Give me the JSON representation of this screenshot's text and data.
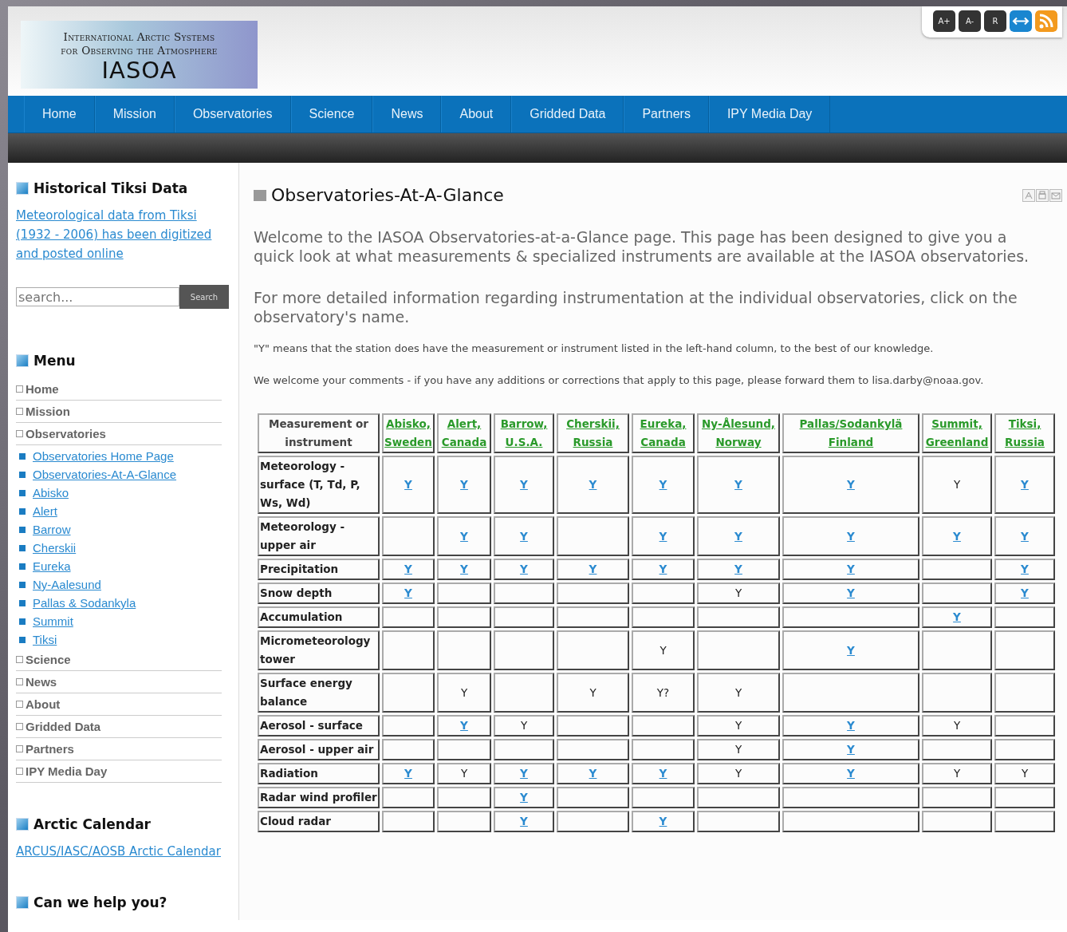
{
  "toolbar": {
    "buttons": [
      "A+",
      "A-",
      "R"
    ]
  },
  "logo": {
    "line1": "International Arctic Systems",
    "line2": "for Observing the Atmosphere",
    "name": "IASOA"
  },
  "nav": [
    "Home",
    "Mission",
    "Observatories",
    "Science",
    "News",
    "About",
    "Gridded Data",
    "Partners",
    "IPY Media Day"
  ],
  "sidebar": {
    "historical": {
      "title": "Historical Tiksi Data",
      "link": "Meteorological data from Tiksi (1932 - 2006) has been digitized and posted online"
    },
    "search": {
      "placeholder": "search...",
      "button": "Search"
    },
    "menu": {
      "title": "Menu",
      "items": [
        {
          "label": "Home"
        },
        {
          "label": "Mission"
        },
        {
          "label": "Observatories",
          "children": [
            "Observatories Home Page",
            "Observatories-At-A-Glance",
            "Abisko",
            "Alert",
            "Barrow",
            "Cherskii",
            "Eureka",
            "Ny-Aalesund",
            "Pallas & Sodankyla",
            "Summit",
            "Tiksi"
          ]
        },
        {
          "label": "Science"
        },
        {
          "label": "News"
        },
        {
          "label": "About"
        },
        {
          "label": "Gridded Data"
        },
        {
          "label": "Partners"
        },
        {
          "label": "IPY Media Day"
        }
      ]
    },
    "calendar": {
      "title": "Arctic Calendar",
      "link": "ARCUS/IASC/AOSB Arctic Calendar"
    },
    "help": {
      "title": "Can we help you?"
    }
  },
  "article": {
    "title": "Observatories-At-A-Glance",
    "intro": [
      "Welcome to the IASOA Observatories-at-a-Glance page.  This page has been designed to give you a quick look at what measurements & specialized instruments are available at the IASOA observatories.",
      "For more detailed information regarding instrumentation at the individual observatories, click on the observatory's name."
    ],
    "notes": [
      "\"Y\" means that the station does have the measurement or instrument listed in the left-hand column, to the best of our knowledge.",
      "We welcome your comments - if you have any additions or corrections that apply to this page, please forward them to lisa.darby@noaa.gov."
    ]
  },
  "table": {
    "columns": [
      {
        "label": "Measurement or instrument",
        "link": false
      },
      {
        "label": "Abisko, Sweden",
        "link": true
      },
      {
        "label": "Alert, Canada",
        "link": true
      },
      {
        "label": "Barrow, U.S.A.",
        "link": true
      },
      {
        "label": "Cherskii, Russia",
        "link": true
      },
      {
        "label": "Eureka, Canada",
        "link": true
      },
      {
        "label": "Ny-Ålesund, Norway",
        "link": true
      },
      {
        "label": "Pallas/Sodankylä Finland",
        "link": true
      },
      {
        "label": "Summit, Greenland",
        "link": true
      },
      {
        "label": "Tiksi, Russia",
        "link": true
      }
    ],
    "rows": [
      {
        "cells": [
          {
            "text": "Meteorology - surface (T, Td, P, Ws, Wd)",
            "link": false
          },
          {
            "text": "Y",
            "link": true
          },
          {
            "text": "Y",
            "link": true
          },
          {
            "text": "Y",
            "link": true
          },
          {
            "text": "Y",
            "link": true
          },
          {
            "text": "Y",
            "link": true
          },
          {
            "text": "Y",
            "link": true
          },
          {
            "text": "Y",
            "link": true
          },
          {
            "text": "Y",
            "link": false
          },
          {
            "text": "Y",
            "link": true
          }
        ]
      },
      {
        "cells": [
          {
            "text": "Meteorology - upper air",
            "link": false
          },
          "",
          {
            "text": "Y",
            "link": true
          },
          {
            "text": "Y",
            "link": true
          },
          "",
          {
            "text": "Y",
            "link": true
          },
          {
            "text": "Y",
            "link": true
          },
          {
            "text": "Y",
            "link": true
          },
          {
            "text": "Y",
            "link": true
          },
          {
            "text": "Y",
            "link": true
          }
        ]
      },
      {
        "cells": [
          {
            "text": "Precipitation",
            "link": false
          },
          {
            "text": "Y",
            "link": true
          },
          {
            "text": "Y",
            "link": true
          },
          {
            "text": "Y",
            "link": true
          },
          {
            "text": "Y",
            "link": true
          },
          {
            "text": "Y",
            "link": true
          },
          {
            "text": "Y",
            "link": true
          },
          {
            "text": "Y",
            "link": true
          },
          "",
          {
            "text": "Y",
            "link": true
          }
        ]
      },
      {
        "cells": [
          {
            "text": "Snow depth",
            "link": false
          },
          {
            "text": "Y",
            "link": true
          },
          "",
          "",
          "",
          "",
          {
            "text": "Y",
            "link": false
          },
          {
            "text": "Y",
            "link": true
          },
          "",
          {
            "text": "Y",
            "link": true
          }
        ]
      },
      {
        "cells": [
          {
            "text": "Accumulation",
            "link": false
          },
          "",
          "",
          "",
          "",
          "",
          "",
          "",
          {
            "text": "Y",
            "link": true
          },
          ""
        ]
      },
      {
        "cells": [
          {
            "text": "Micrometeorology tower",
            "link": false
          },
          "",
          "",
          "",
          "",
          {
            "text": "Y",
            "link": false
          },
          "",
          {
            "text": "Y",
            "link": true
          },
          "",
          ""
        ]
      },
      {
        "cells": [
          {
            "text": "Surface energy balance",
            "link": false
          },
          "",
          {
            "text": "Y",
            "link": false
          },
          "",
          {
            "text": "Y",
            "link": false
          },
          {
            "text": "Y?",
            "link": false
          },
          {
            "text": "Y",
            "link": false
          },
          "",
          "",
          ""
        ]
      },
      {
        "cells": [
          {
            "text": "Aerosol - surface",
            "link": false
          },
          "",
          {
            "text": "Y",
            "link": true
          },
          {
            "text": "Y",
            "link": false
          },
          "",
          "",
          {
            "text": "Y",
            "link": false
          },
          {
            "text": "Y",
            "link": true
          },
          {
            "text": "Y",
            "link": false
          },
          ""
        ]
      },
      {
        "cells": [
          {
            "text": "Aerosol - upper air",
            "link": false
          },
          "",
          "",
          "",
          "",
          "",
          {
            "text": "Y",
            "link": false
          },
          {
            "text": "Y",
            "link": true
          },
          "",
          ""
        ]
      },
      {
        "cells": [
          {
            "text": "Radiation",
            "link": false
          },
          {
            "text": "Y",
            "link": true
          },
          {
            "text": "Y",
            "link": false
          },
          {
            "text": "Y",
            "link": true
          },
          {
            "text": "Y",
            "link": true
          },
          {
            "text": "Y",
            "link": true
          },
          {
            "text": "Y",
            "link": false
          },
          {
            "text": "Y",
            "link": true
          },
          {
            "text": "Y",
            "link": false
          },
          {
            "text": "Y",
            "link": false
          }
        ]
      },
      {
        "cells": [
          {
            "text": "Radar wind profiler",
            "link": false
          },
          "",
          "",
          {
            "text": "Y",
            "link": true
          },
          "",
          "",
          "",
          "",
          "",
          ""
        ]
      },
      {
        "cells": [
          {
            "text": "Cloud radar",
            "link": false
          },
          "",
          "",
          {
            "text": "Y",
            "link": true
          },
          "",
          {
            "text": "Y",
            "link": true
          },
          "",
          "",
          "",
          ""
        ]
      }
    ]
  }
}
